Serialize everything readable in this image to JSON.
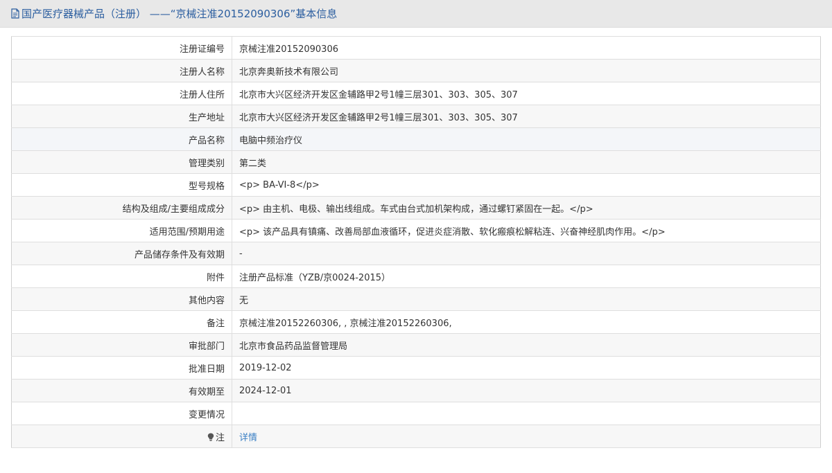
{
  "header": {
    "title": "国产医疗器械产品（注册） ——“京械注准20152090306”基本信息",
    "icon": "document-icon"
  },
  "rows": [
    {
      "label": "注册证编号",
      "value": "京械注准20152090306"
    },
    {
      "label": "注册人名称",
      "value": "北京奔奥新技术有限公司"
    },
    {
      "label": "注册人住所",
      "value": "北京市大兴区经济开发区金辅路甲2号1幢三层301、303、305、307"
    },
    {
      "label": "生产地址",
      "value": "北京市大兴区经济开发区金辅路甲2号1幢三层301、303、305、307"
    },
    {
      "label": "产品名称",
      "value": "电脑中频治疗仪"
    },
    {
      "label": "管理类别",
      "value": "第二类"
    },
    {
      "label": "型号规格",
      "value": "<p> BA-VI-8</p>"
    },
    {
      "label": "结构及组成/主要组成成分",
      "value": "<p> 由主机、电极、输出线组成。车式由台式加机架构成，通过螺钉紧固在一起。</p>"
    },
    {
      "label": "适用范围/预期用途",
      "value": "<p> 该产品具有镇痛、改善局部血液循环，促进炎症消散、软化瘢痕松解粘连、兴奋神经肌肉作用。</p>"
    },
    {
      "label": "产品储存条件及有效期",
      "value": "-"
    },
    {
      "label": "附件",
      "value": "注册产品标准（YZB/京0024-2015）"
    },
    {
      "label": "其他内容",
      "value": "无"
    },
    {
      "label": "备注",
      "value": "京械注准20152260306, , 京械注准20152260306,"
    },
    {
      "label": "审批部门",
      "value": "北京市食品药品监督管理局"
    },
    {
      "label": "批准日期",
      "value": "2019-12-02"
    },
    {
      "label": "有效期至",
      "value": "2024-12-01"
    },
    {
      "label": "变更情况",
      "value": ""
    }
  ],
  "note_row": {
    "label": "注",
    "icon": "lightbulb-icon",
    "link_text": "详情"
  }
}
